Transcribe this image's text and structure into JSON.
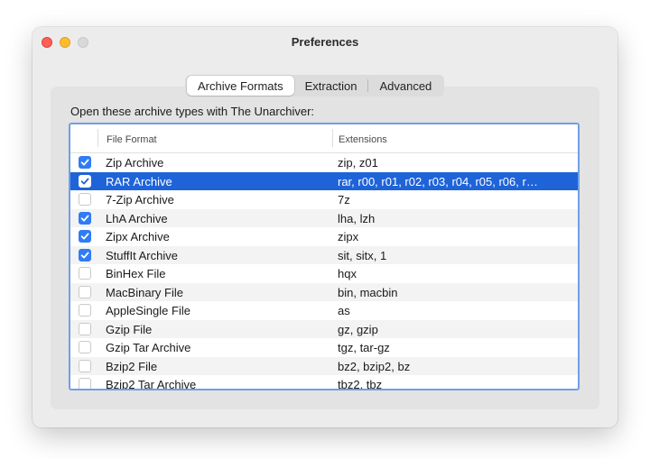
{
  "window": {
    "title": "Preferences"
  },
  "tabs": [
    {
      "label": "Archive Formats",
      "active": true
    },
    {
      "label": "Extraction",
      "active": false
    },
    {
      "label": "Advanced",
      "active": false
    }
  ],
  "prompt": "Open these archive types with The Unarchiver:",
  "table": {
    "columns": {
      "format": "File Format",
      "extensions": "Extensions"
    },
    "rows": [
      {
        "name": "Zip Archive",
        "ext": "zip, z01",
        "checked": true,
        "selected": false
      },
      {
        "name": "RAR Archive",
        "ext": "rar, r00, r01, r02, r03, r04, r05, r06, r…",
        "checked": true,
        "selected": true
      },
      {
        "name": "7-Zip Archive",
        "ext": "7z",
        "checked": false,
        "selected": false
      },
      {
        "name": "LhA Archive",
        "ext": "lha, lzh",
        "checked": true,
        "selected": false
      },
      {
        "name": "Zipx Archive",
        "ext": "zipx",
        "checked": true,
        "selected": false
      },
      {
        "name": "StuffIt Archive",
        "ext": "sit, sitx, 1",
        "checked": true,
        "selected": false
      },
      {
        "name": "BinHex File",
        "ext": "hqx",
        "checked": false,
        "selected": false
      },
      {
        "name": "MacBinary File",
        "ext": "bin, macbin",
        "checked": false,
        "selected": false
      },
      {
        "name": "AppleSingle File",
        "ext": "as",
        "checked": false,
        "selected": false
      },
      {
        "name": "Gzip File",
        "ext": "gz, gzip",
        "checked": false,
        "selected": false
      },
      {
        "name": "Gzip Tar Archive",
        "ext": "tgz, tar-gz",
        "checked": false,
        "selected": false
      },
      {
        "name": "Bzip2 File",
        "ext": "bz2, bzip2, bz",
        "checked": false,
        "selected": false
      },
      {
        "name": "Bzip2 Tar Archive",
        "ext": "tbz2, tbz",
        "checked": false,
        "selected": false
      }
    ]
  },
  "colors": {
    "accent": "#1f63d8",
    "checkbox": "#2f7cf6",
    "focus_ring": "#6f9fe6"
  },
  "icons": {
    "checkbox_checked": "checkmark-icon"
  }
}
